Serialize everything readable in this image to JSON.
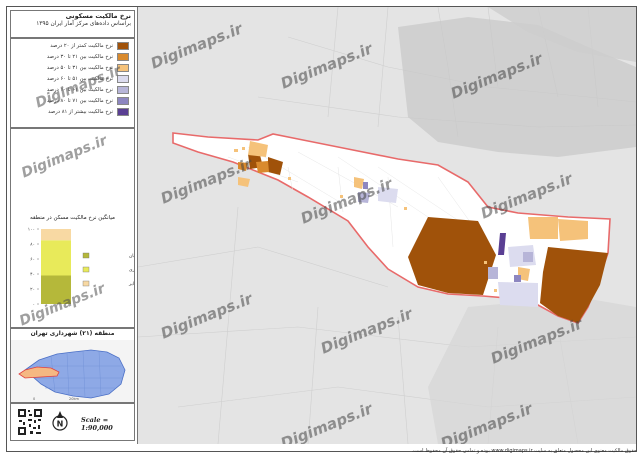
{
  "title": {
    "line1": "نرخ مالکیت مسکونی",
    "line2": "براساس داده‌های مرکز آمار ایران ۱۳۹۵"
  },
  "legend": {
    "items": [
      {
        "label": "نرخ مالکیت کمتر از ۲۰ درصد",
        "color": "#a0520a"
      },
      {
        "label": "نرخ مالکیت بین ۲۱ تا ۳۰ درصد",
        "color": "#d98a2e"
      },
      {
        "label": "نرخ مالکیت بین ۳۱ تا ۵۰ درصد",
        "color": "#f5c27a"
      },
      {
        "label": "نرخ مالکیت بین ۵۱ تا ۶۰ درصد",
        "color": "#dcdcef"
      },
      {
        "label": "نرخ مالکیت بین ۶۱ تا ۷۰ درصد",
        "color": "#b7b5d8"
      },
      {
        "label": "نرخ مالکیت بین ۷۱ تا ۸۰ درصد",
        "color": "#8d86c0"
      },
      {
        "label": "نرخ مالکیت بیشتر از ۸۱ درصد",
        "color": "#5a3f93"
      }
    ]
  },
  "chart": {
    "title": "میانگین نرخ مالکیت مسکن در منطقه",
    "ticks": [
      "۱۰۰",
      "۸۰",
      "۶۰",
      "۴۰",
      "۲۰",
      "۰"
    ],
    "legend": [
      {
        "label": "مالک عرصه و اعیان",
        "color": "#b5b83a"
      },
      {
        "label": "رهن و استیجاری",
        "color": "#e8ea5a"
      },
      {
        "label": "سایر",
        "color": "#f8d9a3"
      }
    ]
  },
  "chart_data": {
    "type": "bar",
    "categories": [
      "میانگین"
    ],
    "series": [
      {
        "name": "مالک عرصه و اعیان",
        "values": [
          38
        ]
      },
      {
        "name": "رهن و استیجاری",
        "values": [
          47
        ]
      },
      {
        "name": "سایر",
        "values": [
          15
        ]
      }
    ],
    "stacked": true,
    "title": "میانگین نرخ مالکیت مسکن در منطقه",
    "ylim": [
      0,
      100
    ]
  },
  "inset": {
    "title": "منطقه (۲۱) شهرداری تهران"
  },
  "scale": {
    "text": "Scale = 1:90,000",
    "north": "N"
  },
  "watermark": {
    "text": "Digimaps.ir"
  },
  "footer": {
    "text": "حقوق مالکیت معنوی این محصول متعلق به سایت www.digimaps.ir بوده و تمامی حقوق آن محفوظ است."
  },
  "colors": {
    "district_outline": "#e86a6a",
    "district_fill": "#ffffff",
    "background_map": "#e4e4e4"
  }
}
